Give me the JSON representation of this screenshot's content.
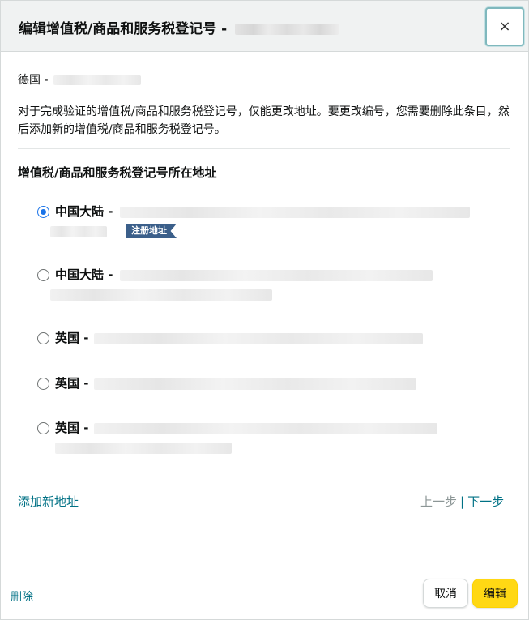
{
  "header": {
    "title": "编辑增值税/商品和服务税登记号 -"
  },
  "close_button": {
    "label": "×"
  },
  "country_line": "德国 -",
  "note": "对于完成验证的增值税/商品和服务税登记号，仅能更改地址。要更改编号，您需要删除此条目，然后添加新的增值税/商品和服务税登记号。",
  "section_title": "增值税/商品和服务税登记号所在地址",
  "addresses": [
    {
      "name": "中国大陆 -",
      "selected": true,
      "badge": "注册地址"
    },
    {
      "name": "中国大陆 -",
      "selected": false
    },
    {
      "name": "英国 -",
      "selected": false
    },
    {
      "name": "英国 -",
      "selected": false
    },
    {
      "name": "英国 -",
      "selected": false
    }
  ],
  "footer": {
    "add_address": "添加新地址",
    "prev": "上一步",
    "separator": "|",
    "next": "下一步",
    "delete": "删除",
    "cancel": "取消",
    "edit": "编辑"
  },
  "colors": {
    "link": "#007185",
    "primary_button": "#ffd814",
    "badge": "#3b5f8a",
    "radio_selected": "#1a73e8"
  }
}
